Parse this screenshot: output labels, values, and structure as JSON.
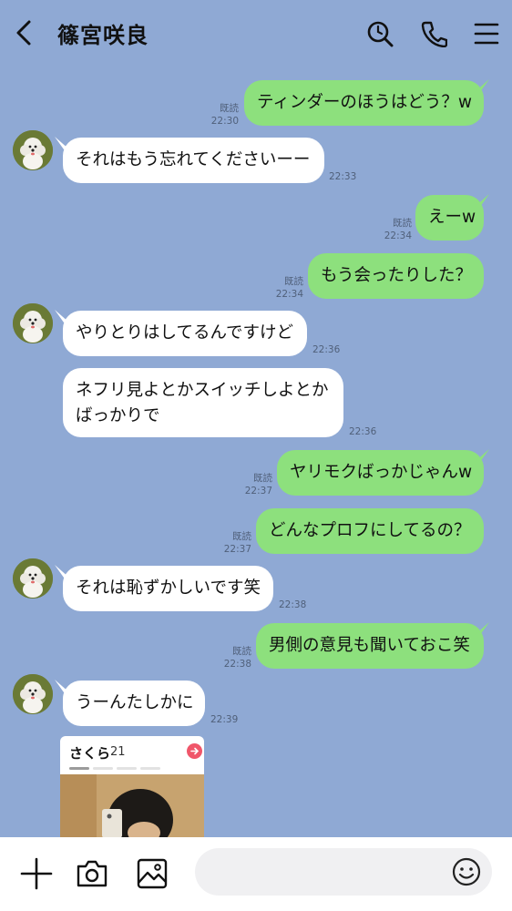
{
  "header": {
    "title": "篠宮咲良",
    "icons": [
      "chevron-left-icon",
      "search-clock-icon",
      "phone-icon",
      "menu-icon"
    ]
  },
  "messages": [
    {
      "from": "me",
      "text": "ティンダーのほうはどう？w",
      "read": "既読",
      "time": "22:30"
    },
    {
      "from": "them",
      "text": "それはもう忘れてくださいーー",
      "time": "22:33"
    },
    {
      "from": "me",
      "text": "えーw",
      "read": "既読",
      "time": "22:34"
    },
    {
      "from": "me",
      "text": "もう会ったりした？",
      "read": "既読",
      "time": "22:34"
    },
    {
      "from": "them",
      "text": "やりとりはしてるんですけど",
      "time": "22:36"
    },
    {
      "from": "them",
      "text_lines": [
        "ネフリ見よとかスイッチしよとか",
        "ばっかりで"
      ],
      "time": "22:36"
    },
    {
      "from": "me",
      "text": "ヤリモクばっかじゃんw",
      "read": "既読",
      "time": "22:37"
    },
    {
      "from": "me",
      "text": "どんなプロフにしてるの？",
      "read": "既読",
      "time": "22:37"
    },
    {
      "from": "them",
      "text": "それは恥ずかしいです笑",
      "time": "22:38"
    },
    {
      "from": "me",
      "text": "男側の意見も聞いておこ笑",
      "read": "既読",
      "time": "22:38"
    },
    {
      "from": "them",
      "text": "うーんたしかに",
      "time": "22:39"
    }
  ],
  "profile_card": {
    "name": "さくら",
    "age": "21"
  },
  "footer": {
    "icons": [
      "plus-icon",
      "camera-icon",
      "image-icon",
      "emoji-icon"
    ],
    "input_placeholder": ""
  },
  "colors": {
    "background": "#8fa9d4",
    "my_bubble": "#8de07d",
    "their_bubble": "#ffffff",
    "accent": "#f0566a"
  }
}
